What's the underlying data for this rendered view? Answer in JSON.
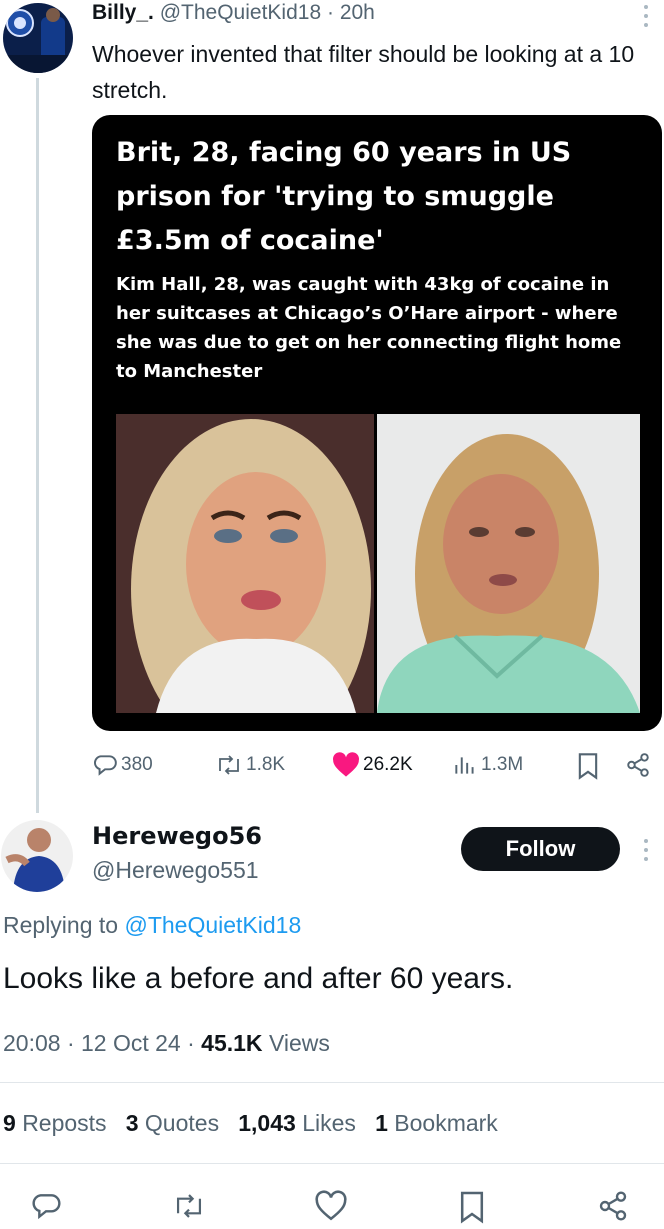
{
  "tweet": {
    "display_name": "Billy_.",
    "handle": "@TheQuietKid18",
    "separator": "·",
    "time": "20h",
    "text": "Whoever invented that filter should be looking at a 10 stretch.",
    "card": {
      "headline": "Brit, 28, facing 60 years in US prison for 'trying to smuggle £3.5m of cocaine'",
      "subhead": "Kim Hall, 28, was caught with 43kg of cocaine in her suitcases at Chicago’s O’Hare airport - where she was due to get on her connecting flight home to Manchester"
    },
    "actions": {
      "replies": "380",
      "reposts": "1.8K",
      "likes": "26.2K",
      "views": "1.3M"
    }
  },
  "reply": {
    "display_name": "Herewego56",
    "handle": "@Herewego551",
    "follow_label": "Follow",
    "replying_prefix": "Replying to",
    "replying_handle": "@TheQuietKid18",
    "text": "Looks like a before and after 60 years.",
    "meta_time": "20:08 · 12 Oct 24 ·",
    "meta_views_count": "45.1K",
    "meta_views_label": "Views",
    "stats": {
      "reposts_count": "9",
      "reposts_label": "Reposts",
      "quotes_count": "3",
      "quotes_label": "Quotes",
      "likes_count": "1,043",
      "likes_label": "Likes",
      "bookmarks_count": "1",
      "bookmarks_label": "Bookmark"
    }
  },
  "colors": {
    "like": "#f91880",
    "muted": "#536471",
    "link": "#1d9bf0",
    "text": "#0f1419"
  }
}
